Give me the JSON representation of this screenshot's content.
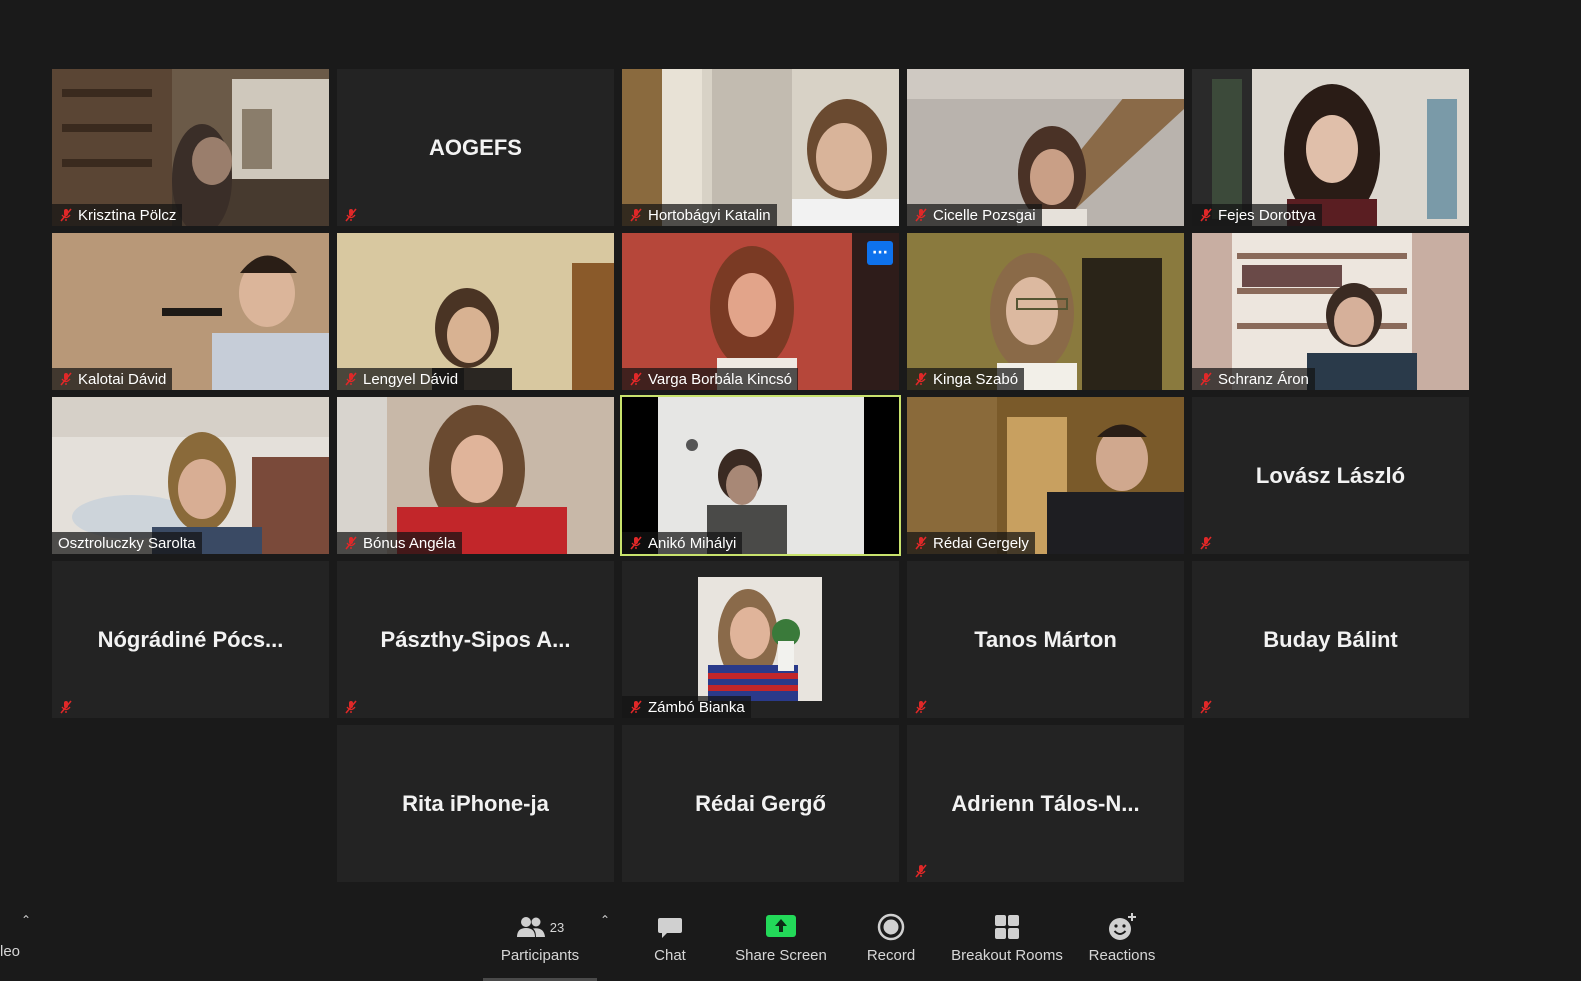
{
  "gallery": {
    "tiles": [
      {
        "name": "Krisztina Pölcz",
        "label": "Krisztina Pölcz",
        "type": "video",
        "scene": "room1"
      },
      {
        "name": "AOGEFS",
        "label": "",
        "type": "name",
        "scene": ""
      },
      {
        "name": "Hortobágyi Katalin",
        "label": "Hortobágyi Katalin",
        "type": "video",
        "scene": "room2"
      },
      {
        "name": "Cicelle Pozsgai",
        "label": "Cicelle Pozsgai",
        "type": "video",
        "scene": "room3"
      },
      {
        "name": "Fejes Dorottya",
        "label": "Fejes Dorottya",
        "type": "video",
        "scene": "room4"
      },
      {
        "name": "Kalotai Dávid",
        "label": "Kalotai Dávid",
        "type": "video",
        "scene": "room5"
      },
      {
        "name": "Lengyel Dávid",
        "label": "Lengyel Dávid",
        "type": "video",
        "scene": "room6"
      },
      {
        "name": "Varga Borbála Kincsó",
        "label": "Varga Borbála Kincsó",
        "type": "video",
        "scene": "room7"
      },
      {
        "name": "Kinga Szabó",
        "label": "Kinga Szabó",
        "type": "video",
        "scene": "room8"
      },
      {
        "name": "Schranz Áron",
        "label": "Schranz Áron",
        "type": "video",
        "scene": "room9"
      },
      {
        "name": "Osztroluczky Sarolta",
        "label": "Osztroluczky Sarolta",
        "type": "video",
        "scene": "room10"
      },
      {
        "name": "Bónus Angéla",
        "label": "Bónus Angéla",
        "type": "video",
        "scene": "room11"
      },
      {
        "name": "Anikó Mihályi",
        "label": "Anikó Mihályi",
        "type": "video",
        "scene": "room12"
      },
      {
        "name": "Rédai Gergely",
        "label": "Rédai Gergely",
        "type": "video",
        "scene": "room13"
      },
      {
        "name": "Lovász László",
        "label": "",
        "type": "name",
        "scene": ""
      },
      {
        "name": "Nógrádiné  Pócs...",
        "label": "",
        "type": "name",
        "scene": ""
      },
      {
        "name": "Pászthy-Sipos  A...",
        "label": "",
        "type": "name",
        "scene": ""
      },
      {
        "name": "Zámbó Bianka",
        "label": "Zámbó Bianka",
        "type": "photo",
        "scene": "photo"
      },
      {
        "name": "Tanos Márton",
        "label": "",
        "type": "name",
        "scene": ""
      },
      {
        "name": "Buday Bálint",
        "label": "",
        "type": "name",
        "scene": ""
      },
      {
        "name": "",
        "label": "",
        "type": "empty",
        "scene": ""
      },
      {
        "name": "Rita iPhone-ja",
        "label": "",
        "type": "name",
        "scene": ""
      },
      {
        "name": "Rédai Gergő",
        "label": "",
        "type": "name",
        "scene": ""
      },
      {
        "name": "Adrienn  Tálos-N...",
        "label": "",
        "type": "name",
        "scene": ""
      }
    ]
  },
  "toolbar": {
    "video_label_partial": "leo",
    "participants_label": "Participants",
    "participants_count": "23",
    "chat_label": "Chat",
    "share_label": "Share Screen",
    "record_label": "Record",
    "breakout_label": "Breakout Rooms",
    "reactions_label": "Reactions",
    "more_dots": "···"
  },
  "colors": {
    "background": "#1a1a1a",
    "tile": "#232323",
    "active_speaker": "#c9e36d",
    "share_green": "#23d959",
    "mute_red": "#e02828",
    "more_blue": "#0e72ed"
  }
}
